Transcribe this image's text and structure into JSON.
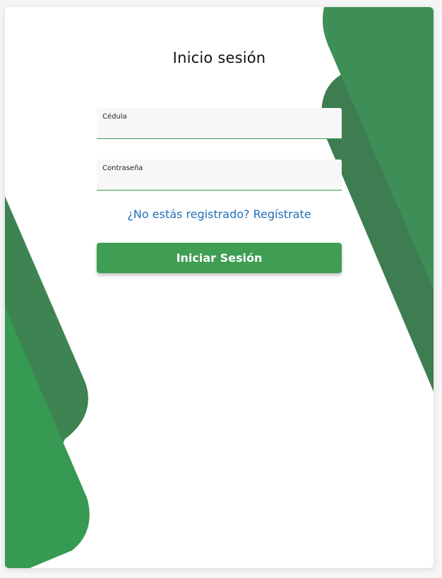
{
  "form": {
    "title": "Inicio sesión",
    "cedula_label": "Cédula",
    "cedula_value": "",
    "password_label": "Contraseña",
    "password_value": "",
    "register_link": "¿No estás registrado? Regístrate",
    "submit_label": "Iniciar Sesión"
  },
  "colors": {
    "accent_green": "#3f9e52",
    "decor_green_light": "#3e8f57",
    "decor_green_dark": "#3e7d52",
    "decor_green_bright": "#369a52",
    "link_blue": "#1f6fb8"
  }
}
